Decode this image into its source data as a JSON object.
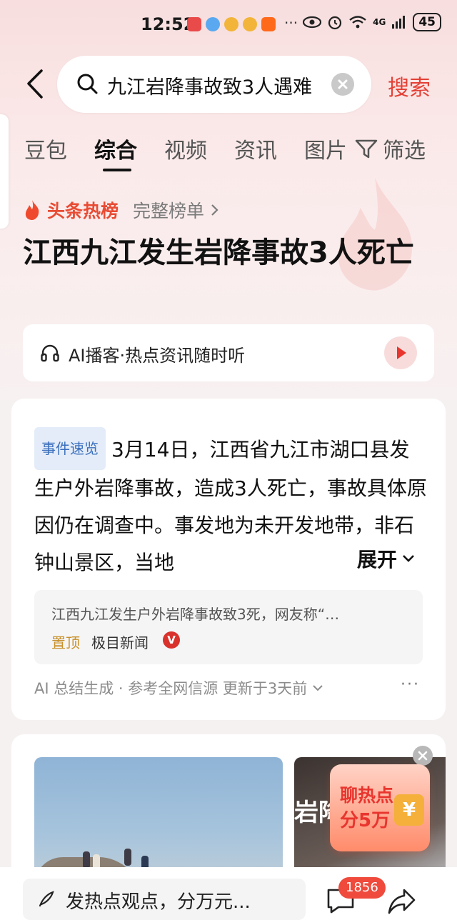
{
  "status_bar": {
    "time": "12:52",
    "more": "···",
    "network": "4G",
    "battery": "45"
  },
  "search": {
    "query": "九江岩降事故致3人遇难",
    "submit_label": "搜索"
  },
  "tabs": [
    {
      "label": "豆包"
    },
    {
      "label": "综合"
    },
    {
      "label": "视频"
    },
    {
      "label": "资讯"
    },
    {
      "label": "图片"
    }
  ],
  "filter_label": "筛选",
  "hot_list": {
    "label": "头条热榜",
    "link": "完整榜单"
  },
  "headline": "江西九江发生岩降事故3人死亡",
  "podcast": {
    "text": "AI播客·热点资讯随时听"
  },
  "summary": {
    "tag": "事件速览",
    "text": "3月14日，江西省九江市湖口县发生户外岩降事故，造成3人死亡，事故具体原因仍在调查中。事发地为未开发地带，非石钟山景区，当地",
    "expand_label": "展开",
    "source_title": "江西九江发生户外岩降事故致3死，网友称“…",
    "pin_label": "置顶",
    "publisher": "极目新闻",
    "verified_badge": "V",
    "footer": "AI 总结生成 · 参考全网信源 更新于3天前",
    "more": "···"
  },
  "media": {
    "photo2_text": "岩降",
    "promo_line1": "聊热点",
    "promo_line2": "分5万",
    "promo_yen": "¥"
  },
  "bottom_bar": {
    "comment_placeholder": "发热点观点，分万元...",
    "comment_count": "1856"
  },
  "colors": {
    "accent_red": "#e44035",
    "tag_blue": "#3b6fbd",
    "pin_gold": "#c8902a"
  }
}
